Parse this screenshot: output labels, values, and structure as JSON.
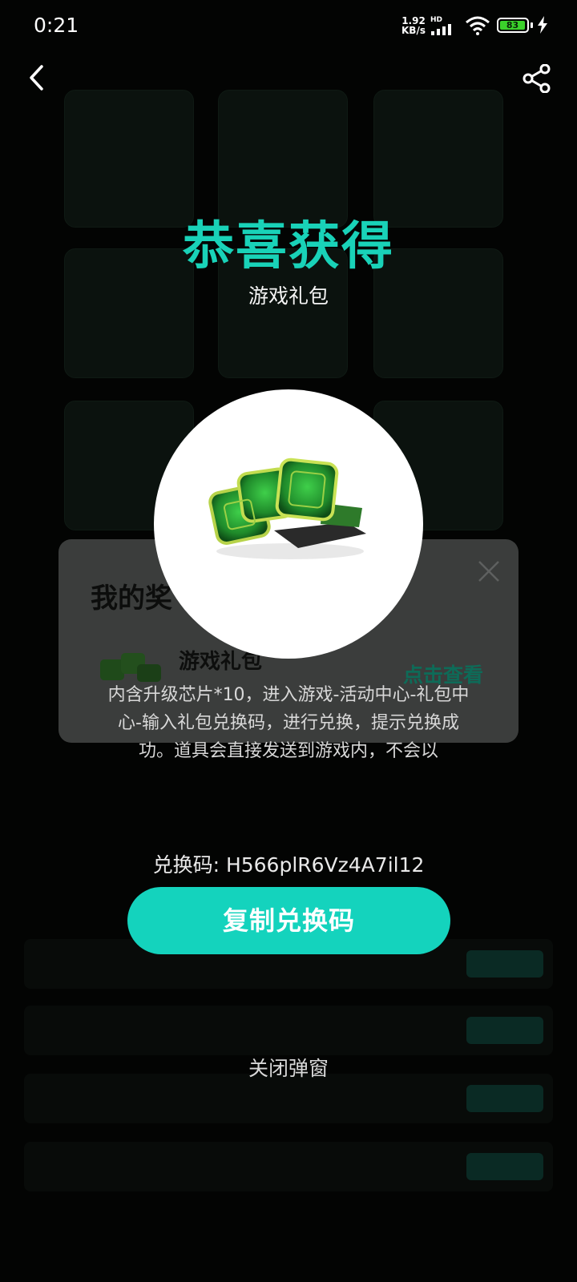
{
  "status_bar": {
    "time": "0:21",
    "speed_top": "1.92",
    "speed_bottom": "KB/s",
    "network": "HD",
    "battery": "83"
  },
  "popup": {
    "title": "恭喜获得",
    "subtitle": "游戏礼包",
    "description": "内含升级芯片*10，进入游戏-活动中心-礼包中心-输入礼包兑换码，进行兑换，提示兑换成功。道具会直接发送到游戏内，不会以",
    "code_text": "兑换码: H566plR6Vz4A7il12",
    "copy_button": "复制兑换码",
    "close_link": "关闭弹窗",
    "colors": {
      "accent": "#19d2b8",
      "button": "#14d3bd"
    }
  },
  "prize_panel": {
    "title": "我的奖",
    "item_name": "游戏礼包",
    "view_link": "点击查看"
  },
  "icons": [
    "back-icon",
    "share-icon",
    "close-icon",
    "chip-pack-image"
  ]
}
